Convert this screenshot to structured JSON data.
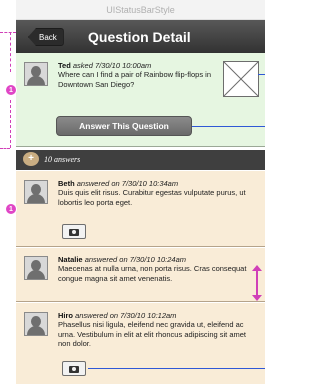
{
  "status_bar": {
    "label": "UIStatusBarStyle"
  },
  "nav": {
    "back_label": "Back",
    "title": "Question Detail"
  },
  "question": {
    "author": "Ted",
    "meta": "asked 7/30/10 10:00am",
    "text": "Where can I find a pair of Rainbow flip-flops in Downtown San Diego?",
    "badge": "1",
    "answer_button": "Answer This Question"
  },
  "answers_header": {
    "icon": "+",
    "count_text": "10 answers"
  },
  "answers": [
    {
      "author": "Beth",
      "meta": "answered on 7/30/10 10:34am",
      "text": "Duis quis elit risus. Curabitur egestas vulputate purus, ut lobortis leo porta eget.",
      "badge": "1"
    },
    {
      "author": "Natalie",
      "meta": "answered on 7/30/10 10:24am",
      "text": "Maecenas at nulla urna, non porta risus. Cras consequat congue magna sit amet venenatis."
    },
    {
      "author": "Hiro",
      "meta": "answered on 7/30/10 10:12am",
      "text": "Phasellus nisi ligula, eleifend nec gravida ut, eleifend ac urna. Vestibulum in elit at elit rhoncus adipiscing sit amet non dolor."
    }
  ],
  "colors": {
    "question_bg": "#e6f6e1",
    "answer_bg": "#f9ecd7",
    "nav_bg": "#3f3f3f",
    "badge": "#e046c6",
    "annotation": "#2f58d6"
  }
}
